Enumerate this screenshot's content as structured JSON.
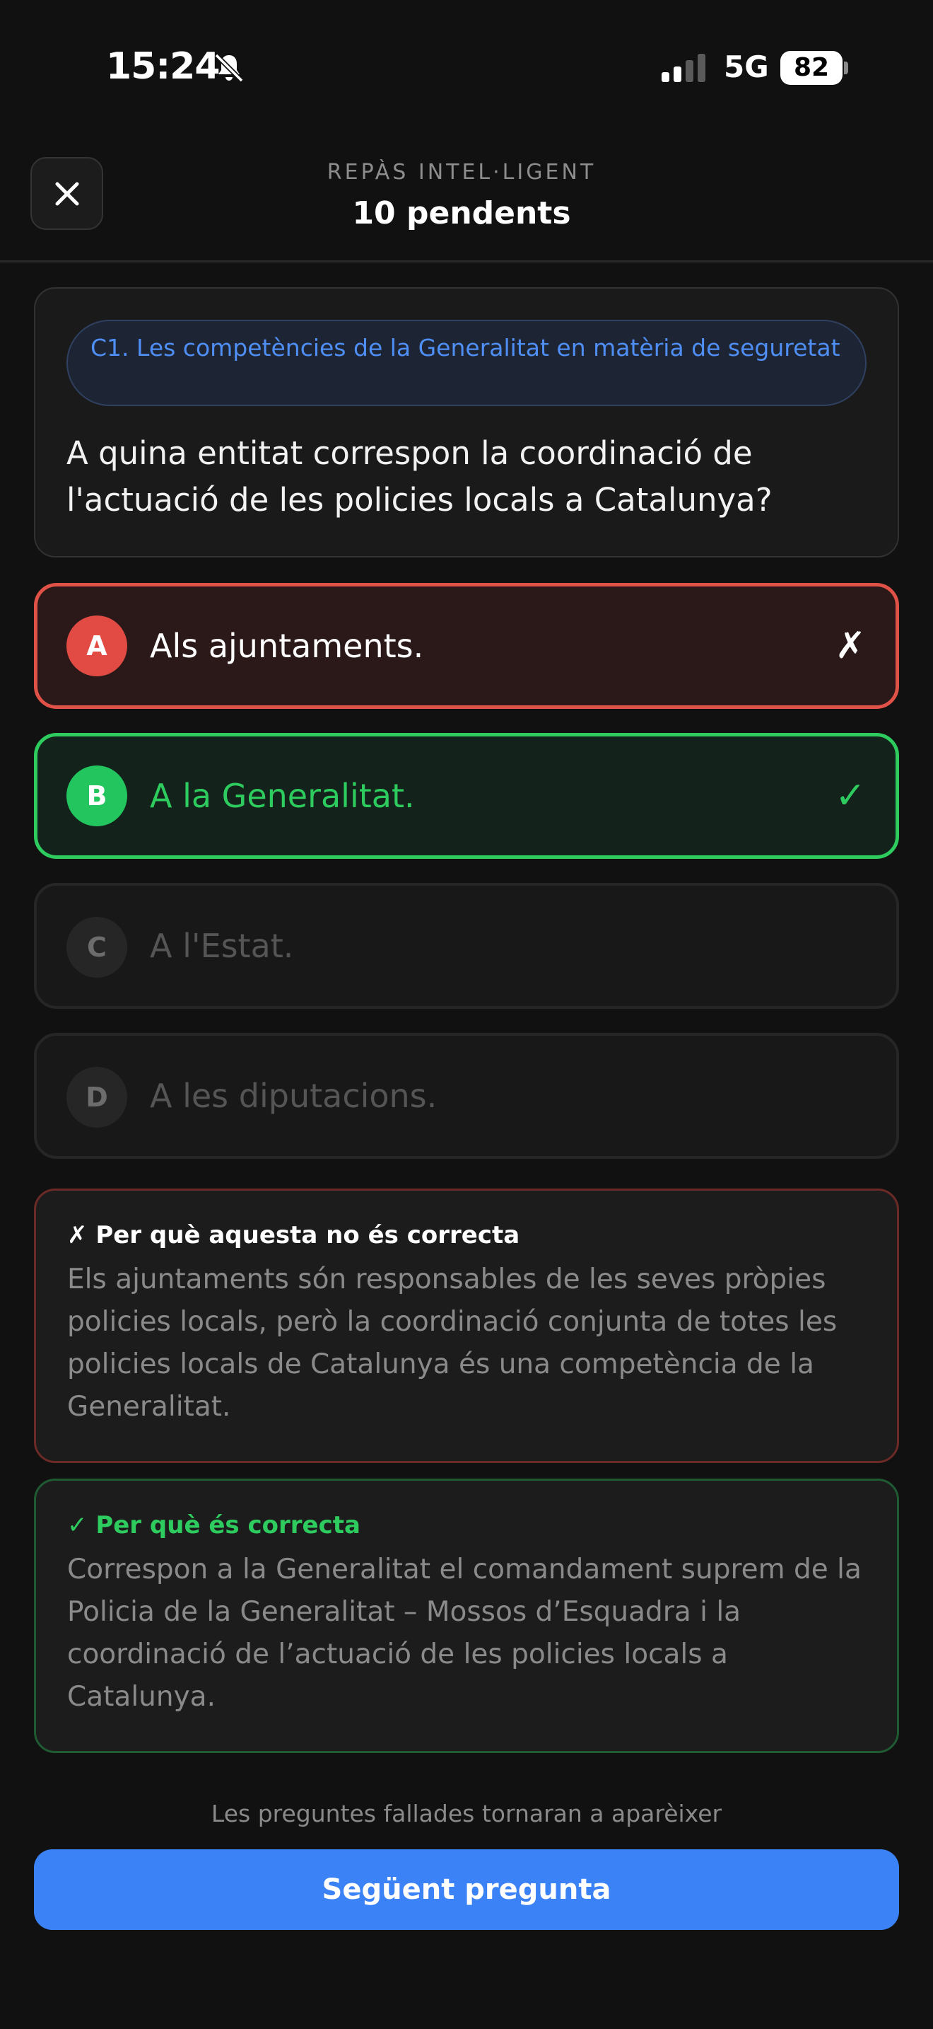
{
  "status_bar": {
    "time": "15:24",
    "network": "5G",
    "battery": "82"
  },
  "header": {
    "kicker": "REPÀS INTEL·LIGENT",
    "title": "10 pendents"
  },
  "question": {
    "topic": "C1. Les competències de la Generalitat en matèria de seguretat",
    "text": "A quina entitat correspon la coordinació de l'actuació de les policies locals a Catalunya?"
  },
  "options": [
    {
      "letter": "A",
      "text": "Als ajuntaments.",
      "mark": "✗",
      "state": "wrong"
    },
    {
      "letter": "B",
      "text": "A la Generalitat.",
      "mark": "✓",
      "state": "correct"
    },
    {
      "letter": "C",
      "text": "A l'Estat.",
      "mark": "",
      "state": "neutral"
    },
    {
      "letter": "D",
      "text": "A les diputacions.",
      "mark": "",
      "state": "neutral"
    }
  ],
  "explanations": {
    "wrong": {
      "heading": "✗ Per què aquesta no és correcta",
      "body": "Els ajuntaments són responsables de les seves pròpies policies locals, però la coordinació conjunta de totes les policies locals de Catalunya és una competència de la Generalitat."
    },
    "right": {
      "heading": "✓ Per què és correcta",
      "body": "Correspon a la Generalitat el comandament suprem de la Policia de la Generalitat – Mossos d’Esquadra i la coordinació de l’actuació de les policies locals a Catalunya."
    }
  },
  "footer": {
    "note": "Les preguntes fallades tornaran a aparèixer",
    "next_label": "Següent pregunta"
  },
  "colors": {
    "accent": "#3b82f6",
    "correct": "#22c55e",
    "wrong": "#e14b44"
  }
}
